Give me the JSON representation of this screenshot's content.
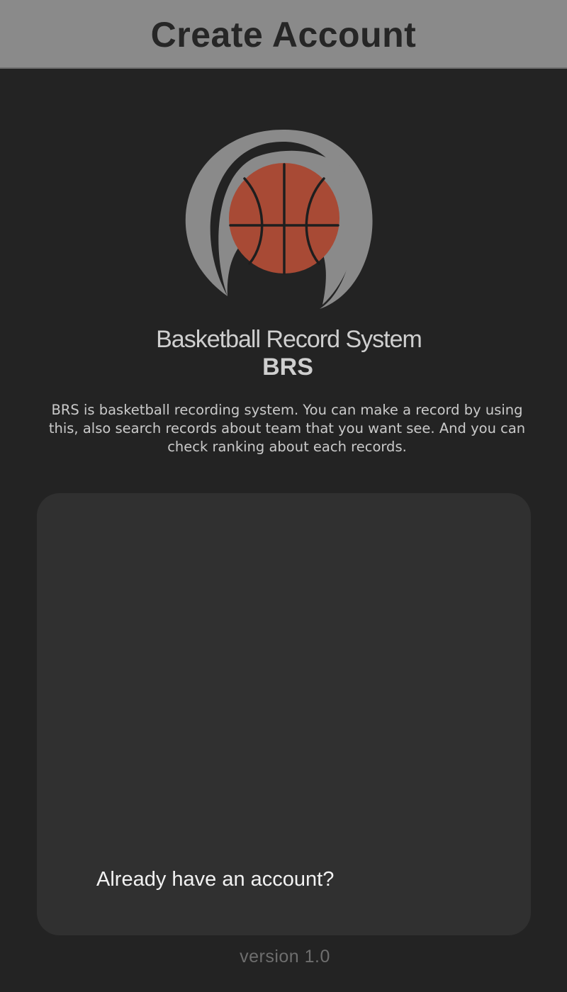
{
  "header": {
    "title": "Create Account"
  },
  "logo": {
    "icon": "basketball-logo-icon",
    "ball_color": "#a84a35",
    "ring_color": "#8a8a8a"
  },
  "app": {
    "name": "Basketball Record System",
    "abbreviation": "BRS",
    "description": "BRS is basketball recording system. You can make a record by using this, also search records about team that you want see. And you can check ranking about each records."
  },
  "card": {
    "signin_link": "Already have an account?"
  },
  "footer": {
    "version": "version 1.0"
  },
  "colors": {
    "background": "#232323",
    "header": "#8a8a8a",
    "card": "#303030"
  }
}
